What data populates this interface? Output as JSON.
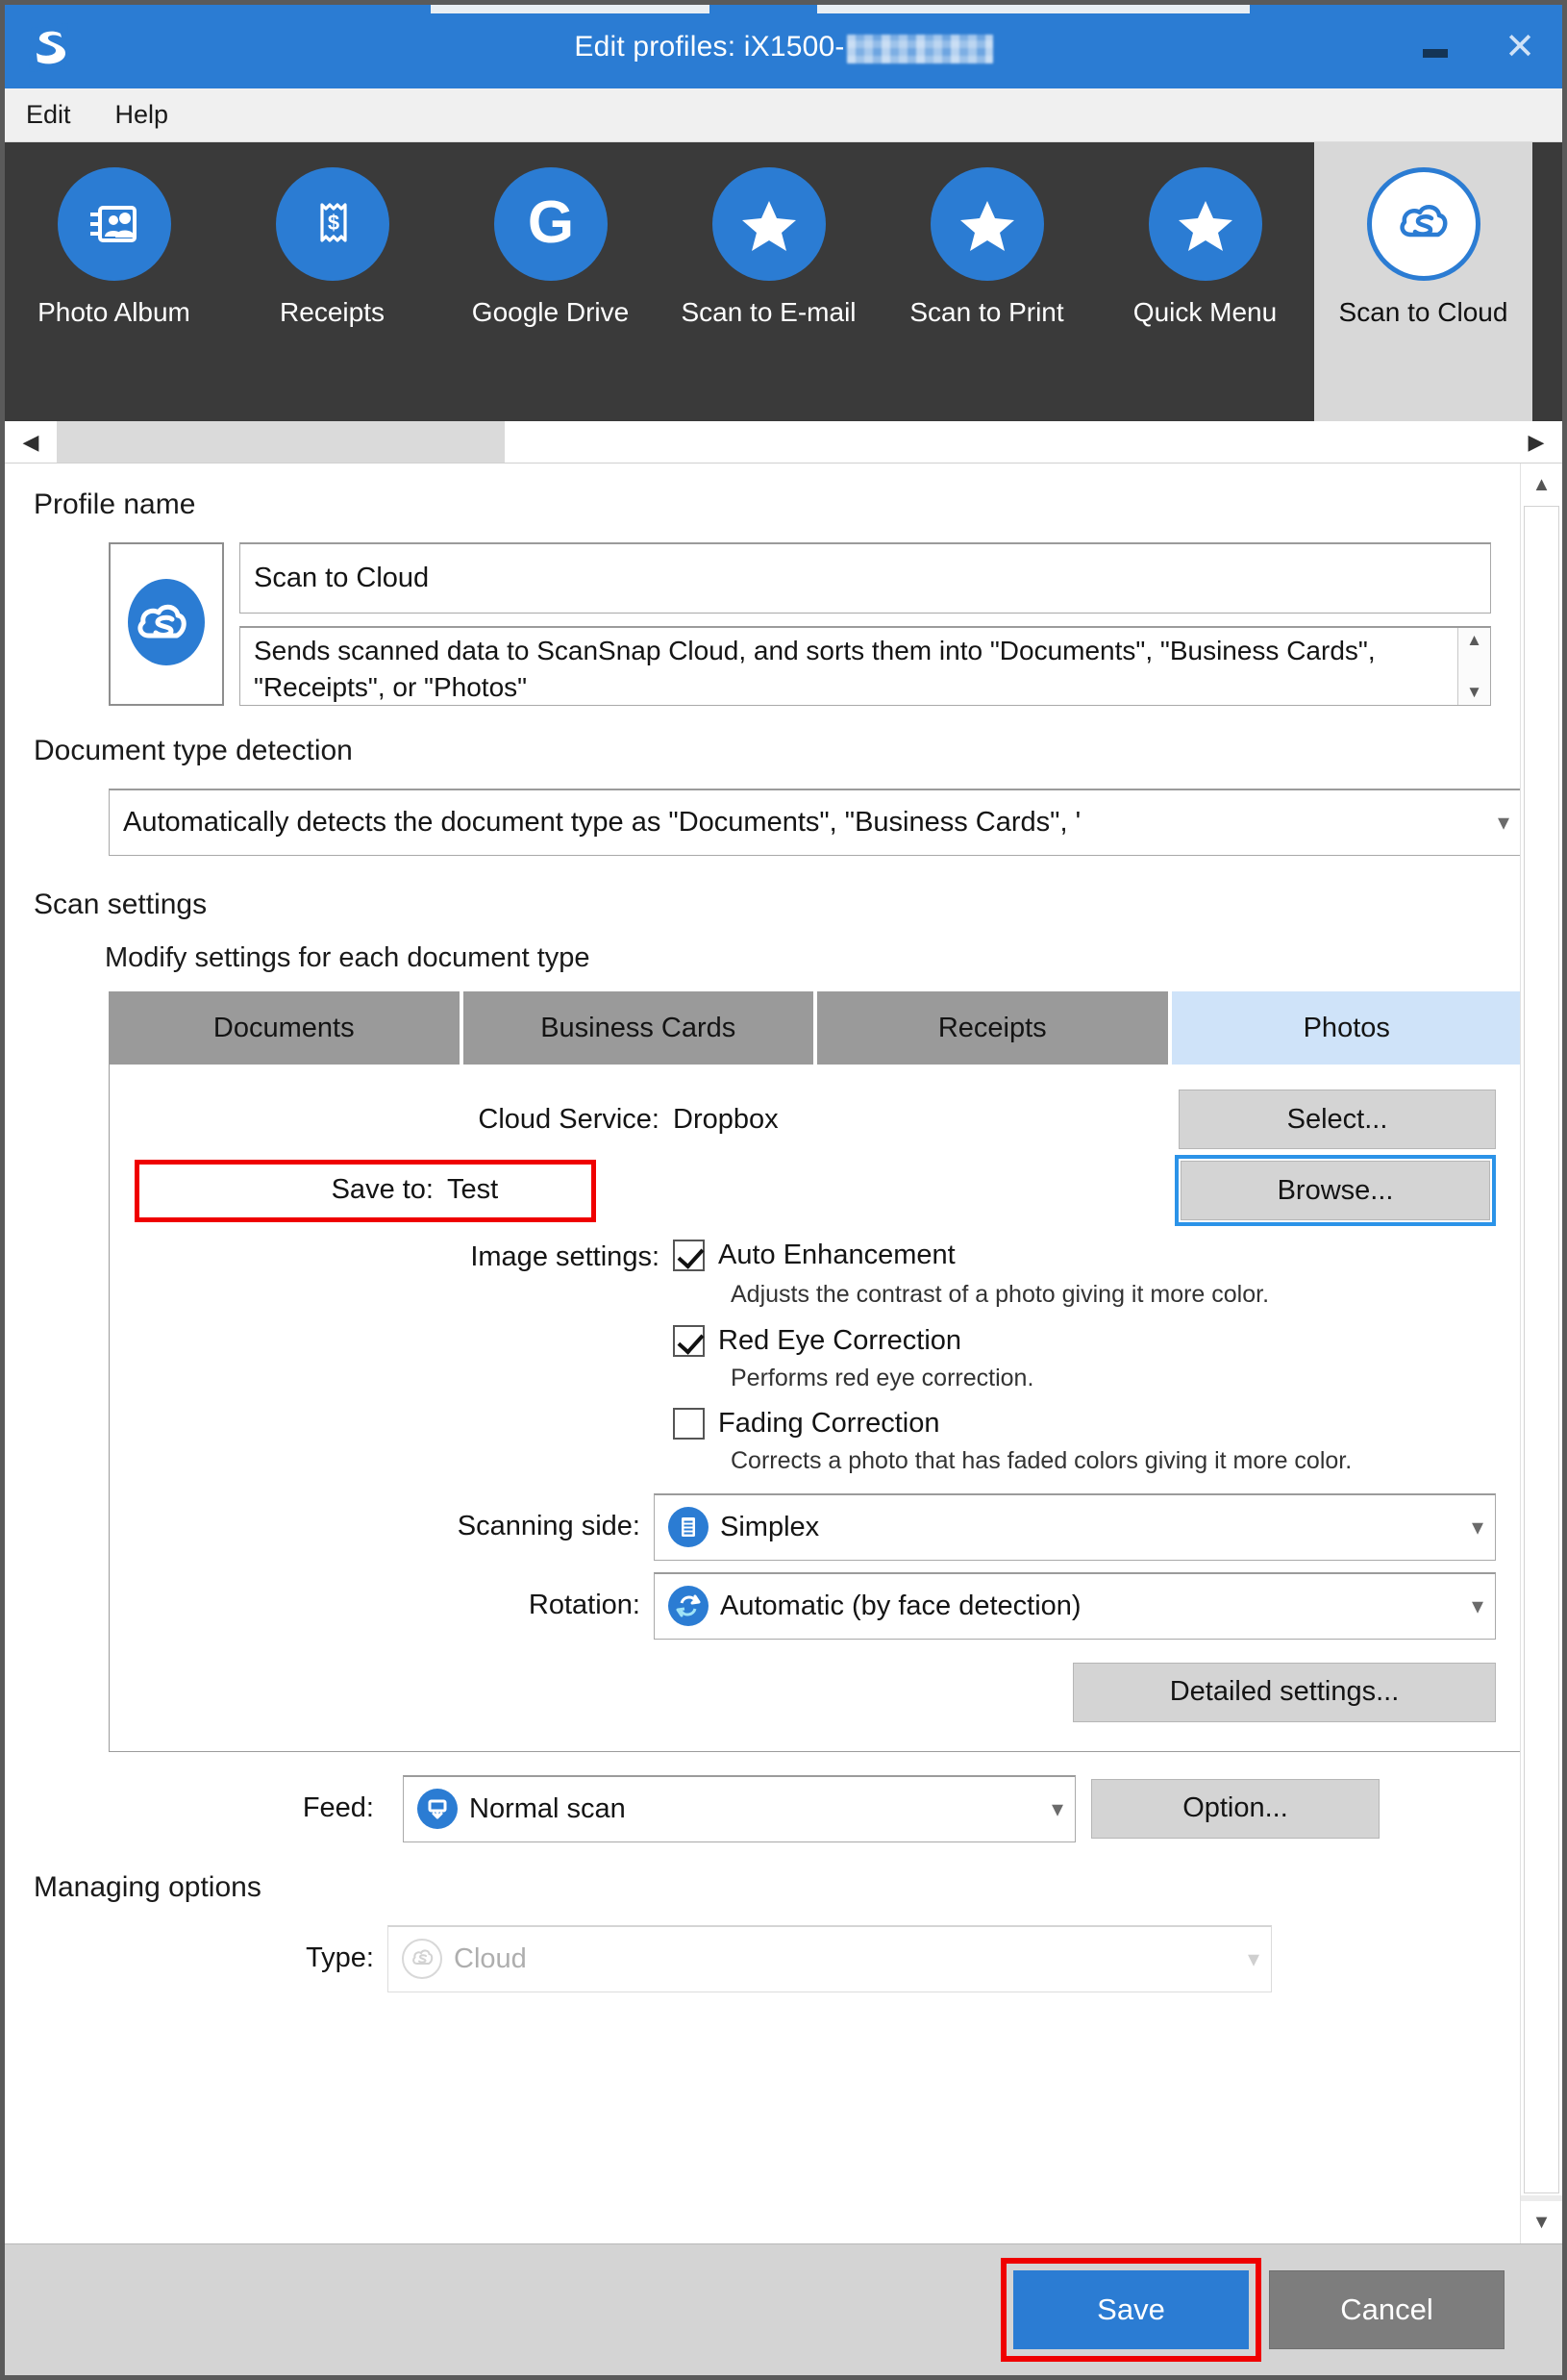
{
  "window": {
    "title_prefix": "Edit profiles: iX1500-",
    "title_redacted": true,
    "minimize_label": "Minimize",
    "close_label": "Close",
    "logo_icon": "scansnap-s-logo-icon",
    "titlebar_color": "#2b7cd3"
  },
  "menubar": {
    "items": [
      {
        "label": "Edit"
      },
      {
        "label": "Help"
      }
    ]
  },
  "profile_strip": {
    "tiles": [
      {
        "label": "Photo Album",
        "icon": "photo-album-icon",
        "selected": false
      },
      {
        "label": "Receipts",
        "icon": "receipt-icon",
        "selected": false
      },
      {
        "label": "Google Drive",
        "icon": "google-g-icon",
        "selected": false
      },
      {
        "label": "Scan to E-mail",
        "icon": "star-icon",
        "selected": false
      },
      {
        "label": "Scan to Print",
        "icon": "star-icon",
        "selected": false
      },
      {
        "label": "Quick Menu",
        "icon": "star-icon",
        "selected": false
      },
      {
        "label": "Scan to Cloud",
        "icon": "scansnap-cloud-icon",
        "selected": true
      }
    ],
    "scroll_left_icon": "chevron-left-icon",
    "scroll_right_icon": "chevron-right-icon"
  },
  "profile_name": {
    "heading": "Profile name",
    "thumb_icon": "scansnap-cloud-icon",
    "name_value": "Scan to Cloud",
    "description_value": "Sends scanned data to ScanSnap Cloud, and sorts them into \"Documents\", \"Business Cards\", \"Receipts\", or \"Photos\"",
    "desc_scroll_up_icon": "triangle-up-icon",
    "desc_scroll_down_icon": "triangle-down-icon"
  },
  "document_type_detection": {
    "heading": "Document type detection",
    "selected": "Automatically detects the document type as \"Documents\", \"Business Cards\", '",
    "caret_icon": "chevron-down-icon"
  },
  "scan_settings": {
    "heading": "Scan settings",
    "subheading": "Modify settings for each document type",
    "tabs": [
      {
        "label": "Documents",
        "active": false
      },
      {
        "label": "Business Cards",
        "active": false
      },
      {
        "label": "Receipts",
        "active": false
      },
      {
        "label": "Photos",
        "active": true
      }
    ],
    "panel": {
      "cloud_service_label": "Cloud Service:",
      "cloud_service_value": "Dropbox",
      "select_button": "Select...",
      "save_to_label": "Save to:",
      "save_to_value": "Test",
      "save_to_highlighted": true,
      "browse_button": "Browse...",
      "browse_focused": true,
      "image_settings_label": "Image settings:",
      "checkboxes": [
        {
          "label": "Auto Enhancement",
          "checked": true,
          "description": "Adjusts the contrast of a photo giving it more color."
        },
        {
          "label": "Red Eye Correction",
          "checked": true,
          "description": "Performs red eye correction."
        },
        {
          "label": "Fading Correction",
          "checked": false,
          "description": "Corrects a photo that has faded colors giving it more color."
        }
      ],
      "scanning_side_label": "Scanning side:",
      "scanning_side_value": "Simplex",
      "scanning_side_icon": "simplex-page-icon",
      "rotation_label": "Rotation:",
      "rotation_value": "Automatic (by face detection)",
      "rotation_icon": "rotate-icon",
      "detailed_settings_button": "Detailed settings..."
    }
  },
  "feed": {
    "label": "Feed:",
    "value": "Normal scan",
    "icon": "feed-icon",
    "option_button": "Option..."
  },
  "managing_options": {
    "heading": "Managing options",
    "type_label": "Type:",
    "type_value": "Cloud",
    "type_icon": "scansnap-cloud-ghost-icon",
    "type_disabled": true
  },
  "footer": {
    "save_label": "Save",
    "save_highlighted": true,
    "cancel_label": "Cancel",
    "save_color": "#2b7cd3",
    "cancel_color": "#7d7d7d",
    "highlight_color": "#ef0000"
  }
}
